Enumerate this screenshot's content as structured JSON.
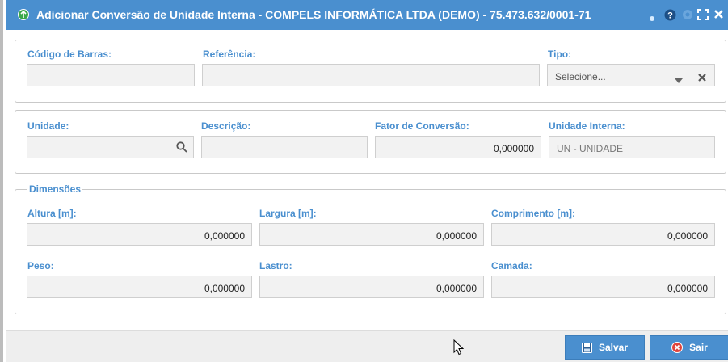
{
  "window": {
    "title": "Adicionar Conversão de Unidade Interna - COMPELS INFORMÁTICA LTDA (DEMO) - 75.473.632/0001-71",
    "controls": {
      "help": "?",
      "close": "✕"
    }
  },
  "identificacao": {
    "codigo_barras_label": "Código de Barras:",
    "codigo_barras_value": "",
    "referencia_label": "Referência:",
    "referencia_value": "",
    "tipo_label": "Tipo:",
    "tipo_selected": "Selecione..."
  },
  "unidade": {
    "unidade_label": "Unidade:",
    "unidade_value": "",
    "descricao_label": "Descrição:",
    "descricao_value": "",
    "fator_label": "Fator de Conversão:",
    "fator_value": "0,000000",
    "unidade_interna_label": "Unidade Interna:",
    "unidade_interna_value": "UN - UNIDADE"
  },
  "dimensoes": {
    "legend": "Dimensões",
    "altura_label": "Altura [m]:",
    "altura_value": "0,000000",
    "largura_label": "Largura [m]:",
    "largura_value": "0,000000",
    "comprimento_label": "Comprimento [m]:",
    "comprimento_value": "0,000000",
    "peso_label": "Peso:",
    "peso_value": "0,000000",
    "lastro_label": "Lastro:",
    "lastro_value": "0,000000",
    "camada_label": "Camada:",
    "camada_value": "0,000000"
  },
  "footer": {
    "save_label": "Salvar",
    "exit_label": "Sair"
  },
  "colors": {
    "accent": "#4a8fcf",
    "field_bg": "#f2f2f2",
    "exit_icon": "#e0443c"
  },
  "icons": [
    "add-icon",
    "minimize-dot-icon",
    "help-icon",
    "settings-icon",
    "maximize-icon",
    "close-icon",
    "dropdown-arrow-icon",
    "clear-icon",
    "search-icon",
    "save-disk-icon",
    "exit-icon",
    "mouse-cursor"
  ]
}
